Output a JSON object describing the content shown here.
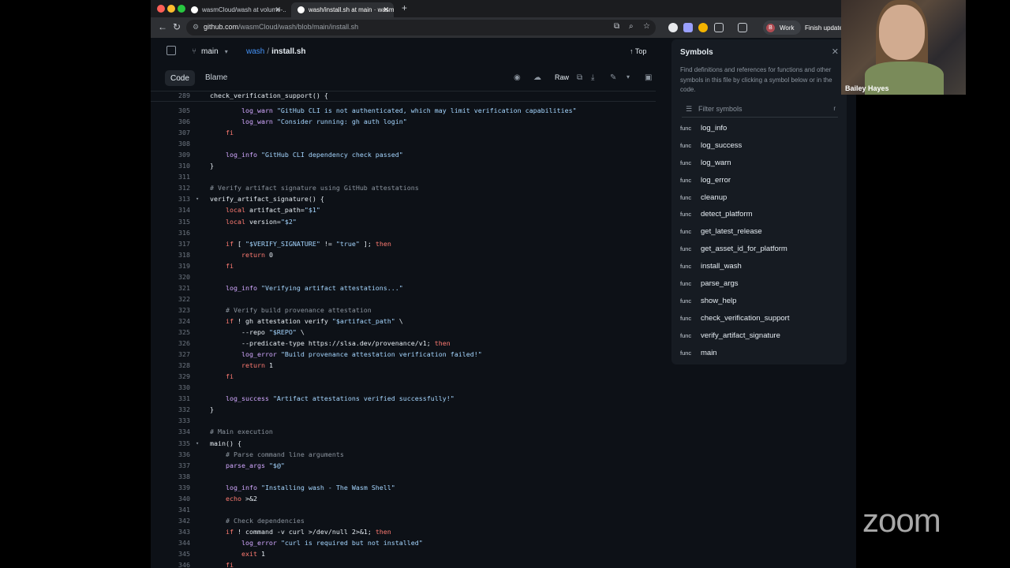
{
  "browser": {
    "tabs": [
      {
        "title": "wasmCloud/wash at volume-..."
      },
      {
        "title": "wash/install.sh at main · wasm..."
      }
    ],
    "url_host": "github.com",
    "url_path": "/wasmCloud/wash/blob/main/install.sh",
    "profile_label": "Work",
    "profile_initial": "B",
    "finish_update": "Finish update"
  },
  "github": {
    "branch": "main",
    "repo": "wash",
    "file": "install.sh",
    "top_label": "Top",
    "code_tab": "Code",
    "blame_tab": "Blame",
    "raw_label": "Raw"
  },
  "code": {
    "sticky": {
      "n": "289",
      "text": "check_verification_support() {"
    },
    "lines": [
      {
        "n": "305",
        "text": "        log_warn \"GitHub CLI is not authenticated, which may limit verification capabilities\""
      },
      {
        "n": "306",
        "text": "        log_warn \"Consider running: gh auth login\""
      },
      {
        "n": "307",
        "text": "    fi"
      },
      {
        "n": "308",
        "text": ""
      },
      {
        "n": "309",
        "text": "    log_info \"GitHub CLI dependency check passed\""
      },
      {
        "n": "310",
        "text": "}"
      },
      {
        "n": "311",
        "text": ""
      },
      {
        "n": "312",
        "text": "# Verify artifact signature using GitHub attestations"
      },
      {
        "n": "313",
        "text": "verify_artifact_signature() {",
        "fold": true
      },
      {
        "n": "314",
        "text": "    local artifact_path=\"$1\""
      },
      {
        "n": "315",
        "text": "    local version=\"$2\""
      },
      {
        "n": "316",
        "text": ""
      },
      {
        "n": "317",
        "text": "    if [ \"$VERIFY_SIGNATURE\" != \"true\" ]; then"
      },
      {
        "n": "318",
        "text": "        return 0"
      },
      {
        "n": "319",
        "text": "    fi"
      },
      {
        "n": "320",
        "text": ""
      },
      {
        "n": "321",
        "text": "    log_info \"Verifying artifact attestations...\""
      },
      {
        "n": "322",
        "text": ""
      },
      {
        "n": "323",
        "text": "    # Verify build provenance attestation"
      },
      {
        "n": "324",
        "text": "    if ! gh attestation verify \"$artifact_path\" \\"
      },
      {
        "n": "325",
        "text": "        --repo \"$REPO\" \\"
      },
      {
        "n": "326",
        "text": "        --predicate-type https://slsa.dev/provenance/v1; then"
      },
      {
        "n": "327",
        "text": "        log_error \"Build provenance attestation verification failed!\""
      },
      {
        "n": "328",
        "text": "        return 1"
      },
      {
        "n": "329",
        "text": "    fi"
      },
      {
        "n": "330",
        "text": ""
      },
      {
        "n": "331",
        "text": "    log_success \"Artifact attestations verified successfully!\""
      },
      {
        "n": "332",
        "text": "}"
      },
      {
        "n": "333",
        "text": ""
      },
      {
        "n": "334",
        "text": "# Main execution"
      },
      {
        "n": "335",
        "text": "main() {",
        "fold": true
      },
      {
        "n": "336",
        "text": "    # Parse command line arguments"
      },
      {
        "n": "337",
        "text": "    parse_args \"$@\""
      },
      {
        "n": "338",
        "text": ""
      },
      {
        "n": "339",
        "text": "    log_info \"Installing wash - The Wasm Shell\""
      },
      {
        "n": "340",
        "text": "    echo >&2"
      },
      {
        "n": "341",
        "text": ""
      },
      {
        "n": "342",
        "text": "    # Check dependencies"
      },
      {
        "n": "343",
        "text": "    if ! command -v curl >/dev/null 2>&1; then"
      },
      {
        "n": "344",
        "text": "        log_error \"curl is required but not installed\""
      },
      {
        "n": "345",
        "text": "        exit 1"
      },
      {
        "n": "346",
        "text": "    fi"
      }
    ]
  },
  "symbols": {
    "title": "Symbols",
    "description": "Find definitions and references for functions and other symbols in this file by clicking a symbol below or in the code.",
    "filter_placeholder": "Filter symbols",
    "filter_shortcut": "r",
    "badge": "func",
    "items": [
      "log_info",
      "log_success",
      "log_warn",
      "log_error",
      "cleanup",
      "detect_platform",
      "get_latest_release",
      "get_asset_id_for_platform",
      "install_wash",
      "parse_args",
      "show_help",
      "check_verification_support",
      "verify_artifact_signature",
      "main"
    ]
  },
  "video": {
    "participant_name": "Bailey Hayes",
    "brand": "zoom"
  }
}
